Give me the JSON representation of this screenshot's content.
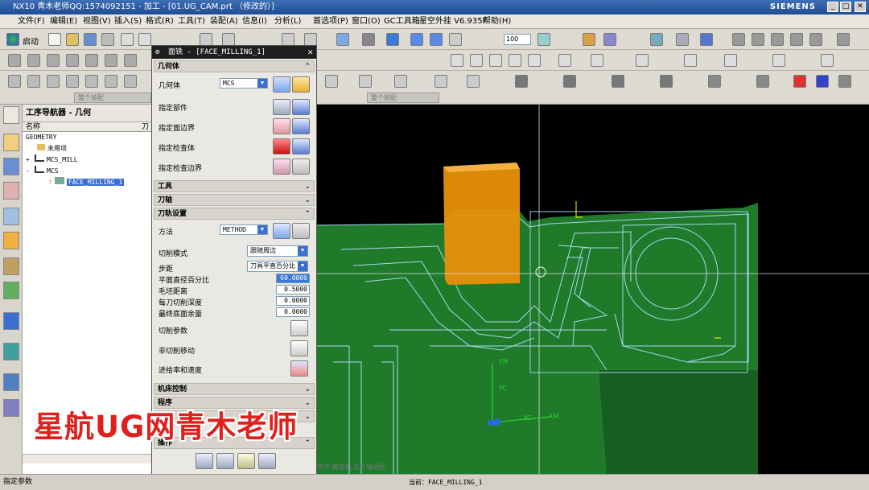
{
  "titlebar": {
    "title": "NX10 青木老师QQ:1574092151 - 加工 - [01.UG_CAM.prt （修改的）]",
    "brand": "SIEMENS"
  },
  "menu": [
    "文件(F)",
    "编辑(E)",
    "视图(V)",
    "插入(S)",
    "格式(R)",
    "工具(T)",
    "装配(A)",
    "信息(I)",
    "分析(L)",
    "首选项(P)",
    "窗口(O)",
    "GC工具箱",
    "星空外挂 V6.935F",
    "帮助(H)"
  ],
  "toolbar": {
    "start_label": "启动",
    "zoom_value": "100",
    "filter1": "整个装配",
    "filter2": "整个装配"
  },
  "navigator": {
    "title": "工序导航器 - 几何",
    "col_name": "名称",
    "col2": "刀",
    "rows": [
      {
        "label": "GEOMETRY",
        "indent": 0,
        "exp": ""
      },
      {
        "label": "未用项",
        "indent": 1,
        "exp": ""
      },
      {
        "label": "MCS_MILL",
        "indent": 1,
        "exp": "+"
      },
      {
        "label": "MCS",
        "indent": 1,
        "exp": "-"
      },
      {
        "label": "FACE_MILLING_1",
        "indent": 2,
        "exp": ""
      }
    ]
  },
  "dialog": {
    "title": "面铣 - [FACE_MILLING_1]",
    "sec_geometry": "几何体",
    "geometry_label": "几何体",
    "geometry_value": "MCS",
    "specify_part": "指定部件",
    "specify_face_boundary": "指定面边界",
    "specify_check_body": "指定检查体",
    "specify_check_boundary": "指定检查边界",
    "sec_tool": "工具",
    "sec_axis": "刀轴",
    "sec_path": "刀轨设置",
    "method_label": "方法",
    "method_value": "METHOD",
    "cut_pattern_label": "切削模式",
    "cut_pattern_value": "跟随周边",
    "stepover_label": "步距",
    "stepover_value": "刀具平直百分比",
    "flat_diam_label": "平面直径百分比",
    "flat_diam_value": "60.0000",
    "blank_dist_label": "毛坯距离",
    "blank_dist_value": "0.5000",
    "depth_label": "每刀切削深度",
    "depth_value": "0.0000",
    "floor_stock_label": "最终底面余量",
    "floor_stock_value": "0.0000",
    "cut_params": "切削参数",
    "non_cut_moves": "非切削移动",
    "feeds_speeds": "进给率和速度",
    "sec_machine": "机床控制",
    "sec_program": "程序",
    "sec_options": "选项",
    "sec_actions": "操作",
    "more": "^^^"
  },
  "viewport": {
    "axis_labels": {
      "ym": "YM",
      "yc": "YC",
      "xc": "XC",
      "xm": "XM"
    },
    "bottom_text": "文件 播放机 正三轴测图"
  },
  "status": {
    "left": "指定参数",
    "center": "当前：FACE_MILLING_1"
  },
  "watermark": "星航UG网青木老师",
  "colors": {
    "part": "#1f7a2a",
    "block": "#e8900a",
    "toolpath": "#a8d8f0",
    "title_dark": "#1e1e1e"
  }
}
